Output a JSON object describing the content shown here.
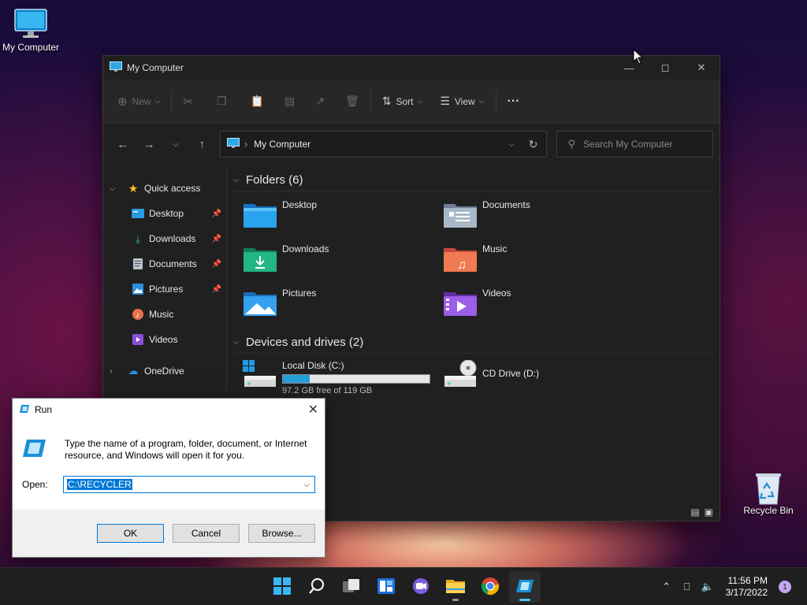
{
  "desktop": {
    "icons": [
      {
        "label": "My Computer",
        "icon": "monitor-icon"
      },
      {
        "label": "Recycle Bin",
        "icon": "recycle-bin-icon"
      }
    ]
  },
  "explorer": {
    "title": "My Computer",
    "command_bar": {
      "new_label": "New",
      "sort_label": "Sort",
      "view_label": "View",
      "more_label": "···"
    },
    "address": {
      "location": "My Computer"
    },
    "search": {
      "placeholder": "Search My Computer"
    },
    "sidebar": {
      "quick_access_label": "Quick access",
      "items": [
        {
          "label": "Desktop",
          "icon": "desktop-folder-icon",
          "pinned": true
        },
        {
          "label": "Downloads",
          "icon": "download-arrow-icon",
          "pinned": true
        },
        {
          "label": "Documents",
          "icon": "document-icon",
          "pinned": true
        },
        {
          "label": "Pictures",
          "icon": "picture-icon",
          "pinned": true
        },
        {
          "label": "Music",
          "icon": "music-icon",
          "pinned": false
        },
        {
          "label": "Videos",
          "icon": "video-icon",
          "pinned": false
        }
      ],
      "onedrive_label": "OneDrive"
    },
    "folders_header": "Folders (6)",
    "folders": [
      {
        "label": "Desktop",
        "color": "#1e90e0",
        "icon": "desktop-folder-icon"
      },
      {
        "label": "Documents",
        "color": "#8da3b8",
        "icon": "documents-folder-icon"
      },
      {
        "label": "Downloads",
        "color": "#1fa37a",
        "icon": "downloads-folder-icon"
      },
      {
        "label": "Music",
        "color": "#e8704a",
        "icon": "music-folder-icon"
      },
      {
        "label": "Pictures",
        "color": "#2b8fe0",
        "icon": "pictures-folder-icon"
      },
      {
        "label": "Videos",
        "color": "#8a4fd8",
        "icon": "videos-folder-icon"
      }
    ],
    "drives_header": "Devices and drives (2)",
    "drives": [
      {
        "label": "Local Disk (C:)",
        "free_text": "97.2 GB free of 119 GB",
        "used_fraction": 0.183,
        "icon": "hard-drive-icon"
      },
      {
        "label": "CD Drive (D:)",
        "icon": "cd-drive-icon"
      }
    ]
  },
  "run_dialog": {
    "title": "Run",
    "description": "Type the name of a program, folder, document, or Internet resource, and Windows will open it for you.",
    "open_label": "Open:",
    "open_value": "C:\\RECYCLER",
    "ok_label": "OK",
    "cancel_label": "Cancel",
    "browse_label": "Browse..."
  },
  "taskbar": {
    "apps": [
      "start-icon",
      "search-icon",
      "task-view-icon",
      "widgets-icon",
      "chat-icon",
      "file-explorer-icon",
      "chrome-icon",
      "run-icon"
    ],
    "time": "11:56 PM",
    "date": "3/17/2022",
    "notification_count": "1",
    "accent": "#4cc2ff"
  }
}
